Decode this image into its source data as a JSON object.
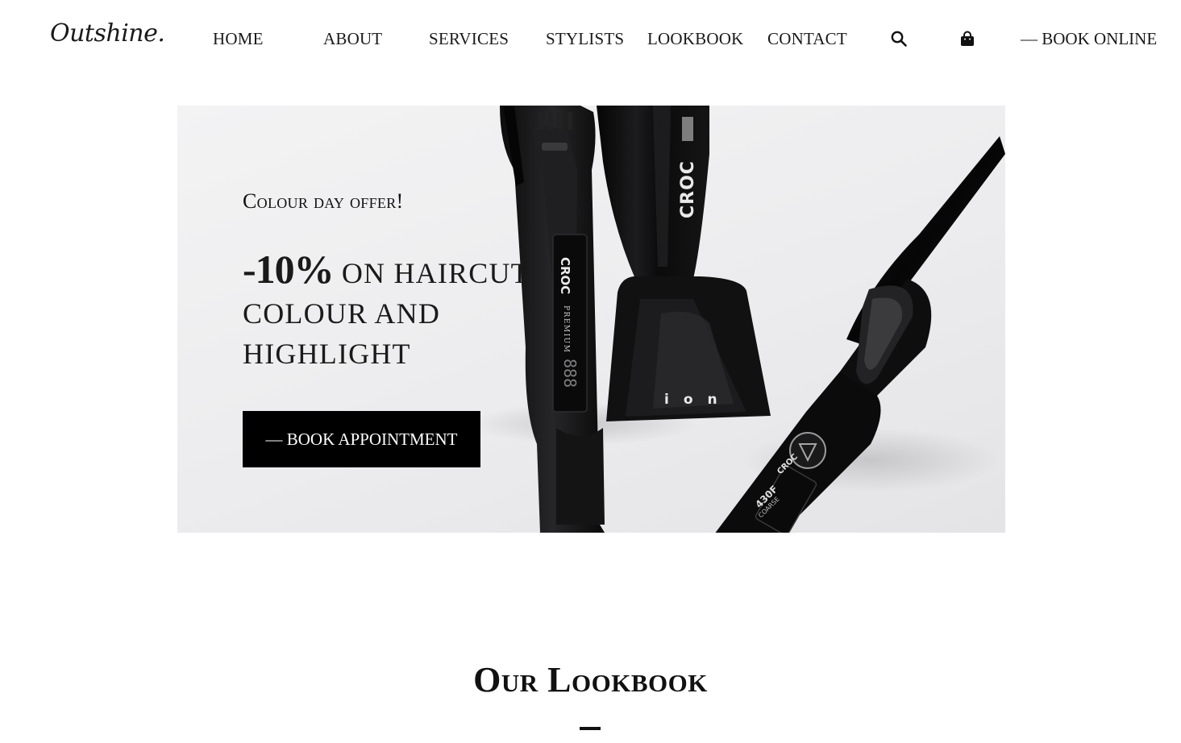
{
  "brand": {
    "logo": "Outshine."
  },
  "nav": {
    "items": [
      {
        "label": "HOME"
      },
      {
        "label": "ABOUT"
      },
      {
        "label": "SERVICES"
      },
      {
        "label": "STYLISTS"
      },
      {
        "label": "LOOKBOOK"
      },
      {
        "label": "CONTACT"
      }
    ],
    "icons": {
      "search": "search-icon",
      "cart": "shopping-bag-icon"
    },
    "book_online": "— BOOK ONLINE"
  },
  "hero": {
    "offer_label": "Colour day offer!",
    "discount": "-10%",
    "headline_line1": "on haircut",
    "headline_line2": "colour and",
    "headline_line3": "highlight",
    "cta_label": "— BOOK APPOINTMENT",
    "product_brand": "CROC",
    "product_premium": "PREMIUM",
    "product_display": "888",
    "product_ion": "ion",
    "product_temp": "430F",
    "product_coarse": "COARSE"
  },
  "lookbook": {
    "title": "Our Lookbook"
  },
  "colors": {
    "accent": "#000000",
    "background": "#ffffff",
    "hero_bg": "#ececee"
  }
}
